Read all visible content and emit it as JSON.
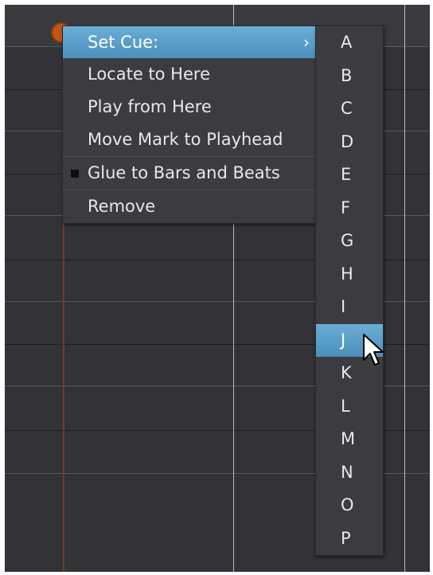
{
  "context_menu": {
    "items": [
      {
        "label": "Set Cue:",
        "has_submenu": true,
        "highlighted": true,
        "submenu_arrow": "›"
      },
      {
        "label": "Locate to Here"
      },
      {
        "label": "Play from Here"
      },
      {
        "label": "Move Mark to Playhead"
      },
      {
        "label": "Glue to Bars and Beats",
        "checked": true
      },
      {
        "label": "Remove"
      }
    ]
  },
  "cue_submenu": {
    "items": [
      "A",
      "B",
      "C",
      "D",
      "E",
      "F",
      "G",
      "H",
      "I",
      "J",
      "K",
      "L",
      "M",
      "N",
      "O",
      "P"
    ],
    "highlighted": "J"
  },
  "colors": {
    "highlight": "#5a9fcb",
    "menu_background": "#3c3c40",
    "editor_background": "#333337",
    "marker": "#c45515"
  },
  "icons": {
    "submenu_arrow": "chevron-right-icon",
    "checked": "checkbox-filled-icon",
    "cursor": "mouse-pointer-icon",
    "marker": "location-marker-icon"
  }
}
